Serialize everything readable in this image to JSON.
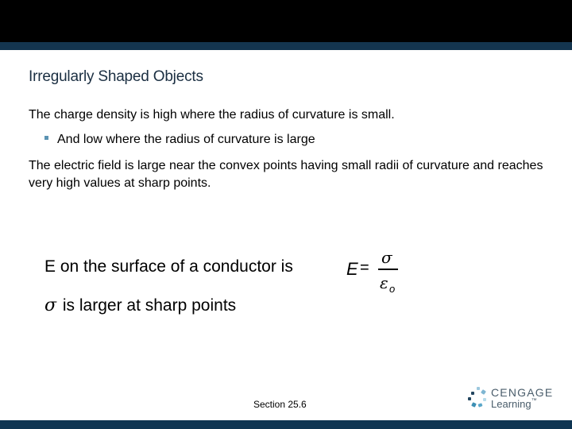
{
  "header": {
    "title": "Irregularly Shaped Objects"
  },
  "body": {
    "line1": "The charge density is high where the radius of curvature is small.",
    "bullet1": "And low where the radius of curvature is large",
    "line3": "The electric field is large near the convex points having small radii of curvature and reaches very high values at sharp points.",
    "e_statement": "E on the surface of a conductor is",
    "sigma_symbol": "σ",
    "sigma_statement": "is larger at sharp points",
    "formula": {
      "lhs": "E",
      "equals": "=",
      "numerator": "σ",
      "denominator": "ε",
      "subscript": "o"
    }
  },
  "footer": {
    "section": "Section  25.6",
    "logo_top": "CENGAGE",
    "logo_bottom": "Learning",
    "logo_tm": "™"
  },
  "colors": {
    "header_black": "#000000",
    "header_band": "#14354f",
    "footer_band": "#0e3552",
    "title": "#1b2f42",
    "bullet": "#5b93b3"
  }
}
